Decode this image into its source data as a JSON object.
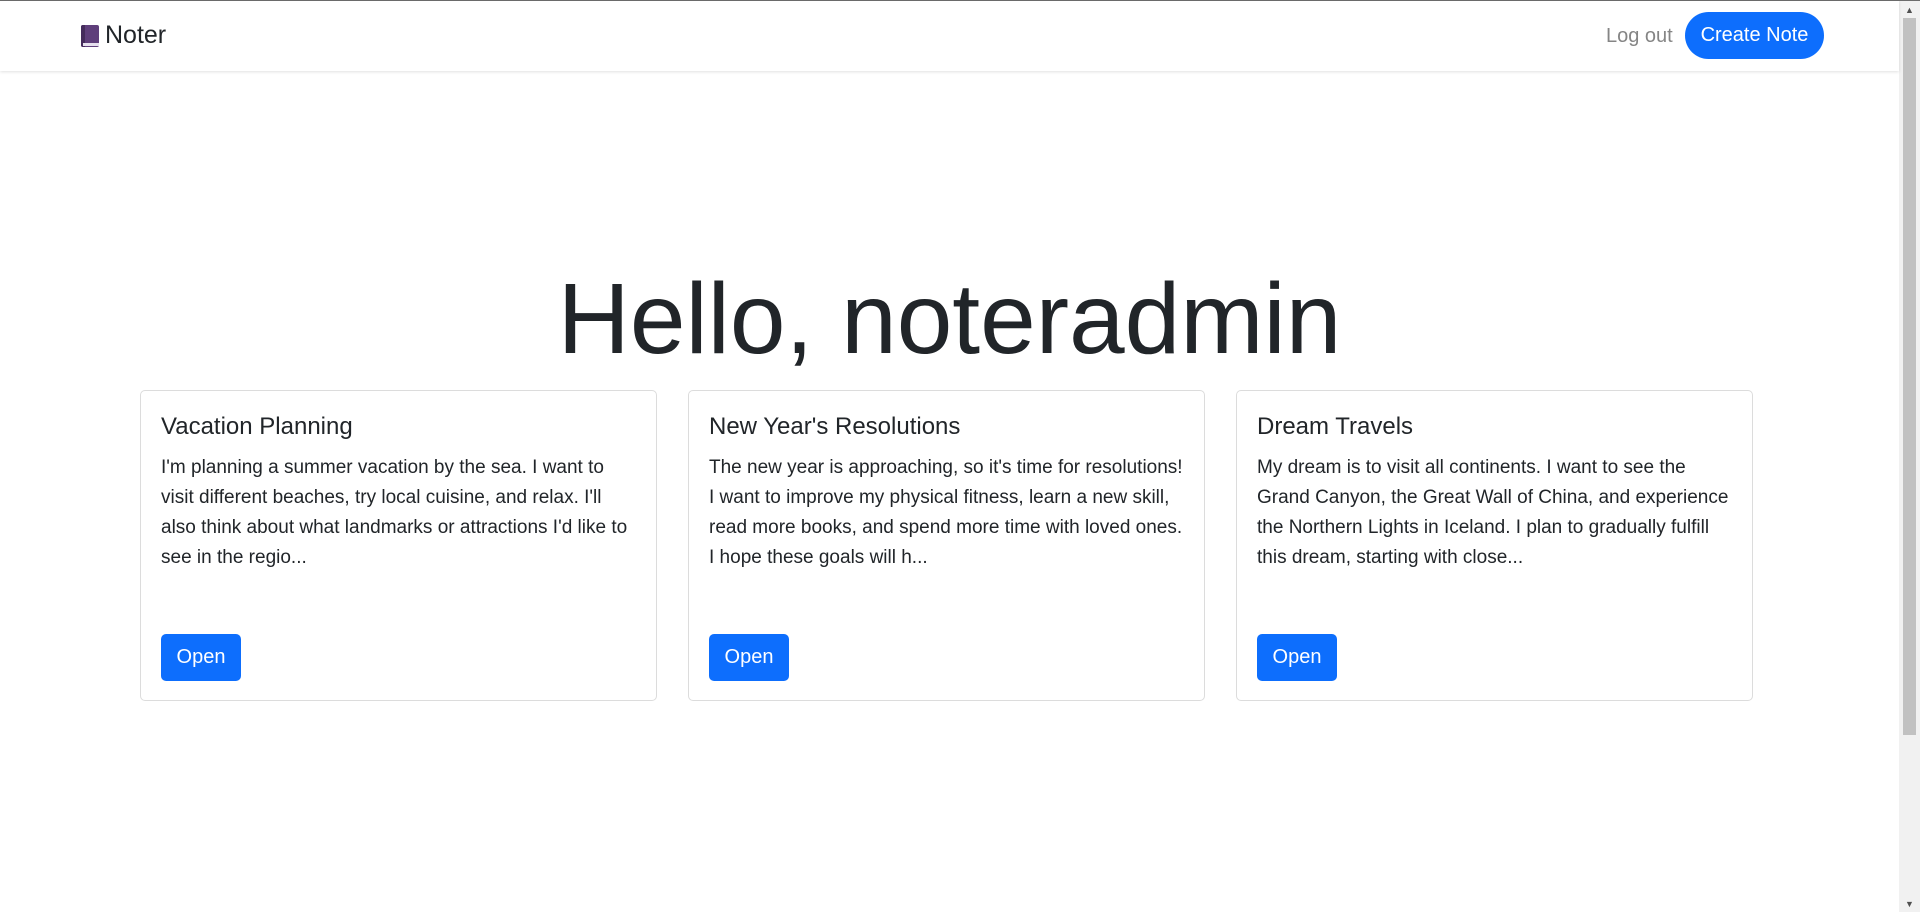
{
  "navbar": {
    "brand_icon": "notebook-icon",
    "brand_label": "Noter",
    "logout_label": "Log out",
    "create_label": "Create Note"
  },
  "main": {
    "greeting": "Hello, noteradmin"
  },
  "notes": [
    {
      "title": "Vacation Planning",
      "excerpt": "I'm planning a summer vacation by the sea. I want to visit different beaches, try local cuisine, and relax. I'll also think about what landmarks or attractions I'd like to see in the regio...",
      "open_label": "Open"
    },
    {
      "title": "New Year's Resolutions",
      "excerpt": "The new year is approaching, so it's time for resolutions! I want to improve my physical fitness, learn a new skill, read more books, and spend more time with loved ones. I hope these goals will h...",
      "open_label": "Open"
    },
    {
      "title": "Dream Travels",
      "excerpt": "My dream is to visit all continents. I want to see the Grand Canyon, the Great Wall of China, and experience the Northern Lights in Iceland. I plan to gradually fulfill this dream, starting with close...",
      "open_label": "Open"
    }
  ],
  "colors": {
    "primary": "#0d6efd",
    "text": "#212529",
    "muted": "#858585",
    "brand_icon": "#5f3f7b"
  }
}
